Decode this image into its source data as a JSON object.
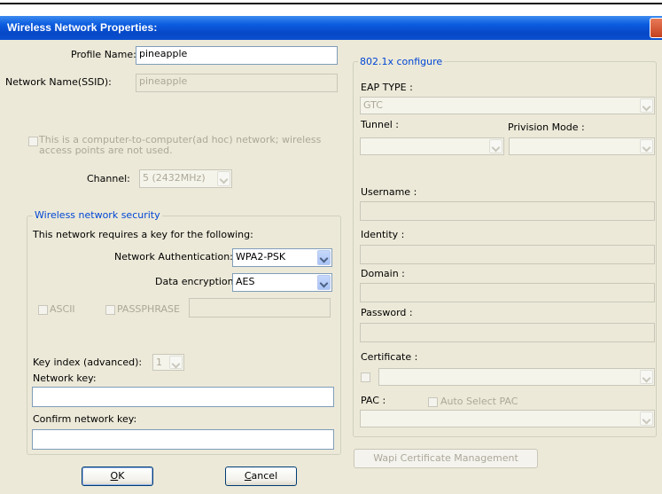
{
  "window": {
    "title": "Wireless Network Properties:"
  },
  "profile": {
    "label": "Profile Name:",
    "value": "pineapple"
  },
  "ssid": {
    "label": "Network Name(SSID):",
    "value": "pineapple"
  },
  "adhoc": {
    "label_line1": "This is a computer-to-computer(ad hoc) network; wireless",
    "label_line2": "access points are not used."
  },
  "channel": {
    "label": "Channel:",
    "value": "5  (2432MHz)"
  },
  "security": {
    "title": "Wireless network security",
    "requires_text": "This network requires a key for the following:",
    "auth_label": "Network Authentication:",
    "auth_value": "WPA2-PSK",
    "enc_label": "Data encryption:",
    "enc_value": "AES",
    "ascii_label": "ASCII",
    "passphrase_label": "PASSPHRASE",
    "key_index_label": "Key index (advanced):",
    "key_index_value": "1",
    "network_key_label": "Network key:",
    "network_key_value": "",
    "confirm_key_label": "Confirm network key:",
    "confirm_key_value": ""
  },
  "buttons": {
    "ok_prefix": "",
    "ok_underlined": "O",
    "ok_suffix": "K",
    "cancel_underlined": "C",
    "cancel_suffix": "ancel"
  },
  "eap": {
    "title": "802.1x configure",
    "eap_type_label": "EAP TYPE :",
    "eap_type_value": "GTC",
    "tunnel_label": "Tunnel :",
    "tunnel_value": "",
    "provision_label": "Privision Mode :",
    "provision_value": "",
    "username_label": "Username :",
    "identity_label": "Identity :",
    "domain_label": "Domain :",
    "password_label": "Password :",
    "certificate_label": "Certificate :",
    "certificate_value": "",
    "pac_label": "PAC :",
    "auto_pac_label": "Auto Select PAC",
    "pac_value": "",
    "wapi_button": "Wapi Certificate Management"
  }
}
